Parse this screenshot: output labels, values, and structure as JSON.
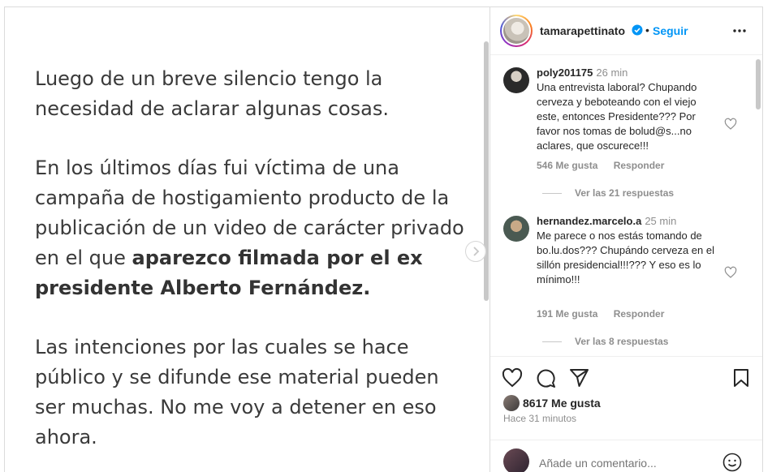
{
  "post": {
    "paragraph1": "Luego de un breve silencio tengo la necesidad de aclarar algunas cosas.",
    "paragraph2_start": "En los últimos días fui víctima de una campaña de hostigamiento producto de la publicación de un video de carácter privado en el que ",
    "paragraph2_bold": "aparezco filmada por el ex presidente Alberto Fernández.",
    "paragraph3": "Las intenciones por las cuales se hace público y se difunde ese material pueden ser muchas. No me voy a detener en eso ahora."
  },
  "header": {
    "username": "tamarapettinato",
    "separator": "•",
    "follow_label": "Seguir"
  },
  "comments": [
    {
      "user": "poly201175",
      "time": "26 min",
      "text": "Una entrevista laboral? Chupando cerveza y beboteando con el viejo este, entonces Presidente??? Por favor nos tomas de bolud@s...no aclares, que oscurece!!!",
      "likes": "546 Me gusta",
      "reply_label": "Responder",
      "view_replies": "Ver las 21 respuestas"
    },
    {
      "user": "hernandez.marcelo.a",
      "time": "25 min",
      "text": "Me parece o nos estás tomando de bo.lu.dos??? Chupándo cerveza en el sillón presidencial!!!??? Y eso es lo mínimo!!!",
      "likes": "191 Me gusta",
      "reply_label": "Responder",
      "view_replies": "Ver las 8 respuestas"
    }
  ],
  "actions": {
    "likes_count": "8617 Me gusta",
    "time_ago": "Hace 31 minutos"
  },
  "add_comment": {
    "placeholder": "Añade un comentario..."
  },
  "colors": {
    "accent": "#0095f6",
    "muted": "#8e8e8e",
    "text": "#262626",
    "border": "#dbdbdb"
  },
  "icons": [
    "next-arrow-icon",
    "verified-icon",
    "more-options-icon",
    "heart-icon",
    "comment-icon",
    "share-icon",
    "save-icon",
    "emoji-icon"
  ]
}
